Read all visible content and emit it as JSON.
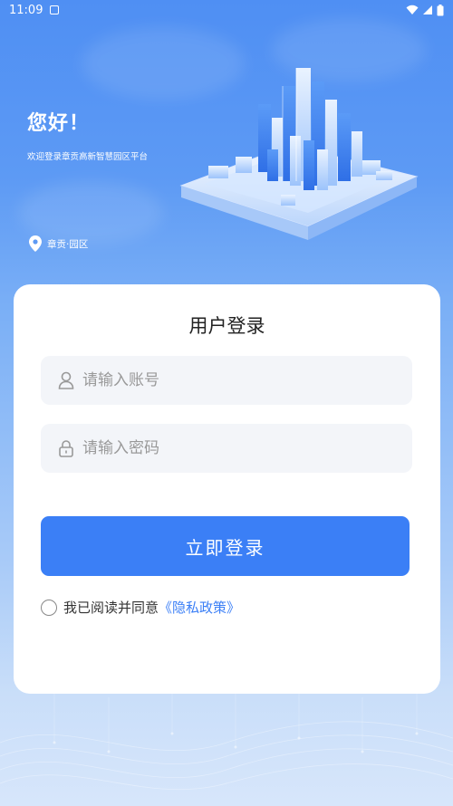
{
  "status_bar": {
    "time": "11:09"
  },
  "header": {
    "greeting": "您好！",
    "subtitle": "欢迎登录章贡高新智慧园区平台",
    "location": "章贡·园区"
  },
  "login": {
    "title": "用户登录",
    "account_placeholder": "请输入账号",
    "password_placeholder": "请输入密码",
    "submit_label": "立即登录",
    "agree_text": "我已阅读并同意",
    "policy_link": "《隐私政策》"
  },
  "colors": {
    "primary": "#3b7ff6",
    "background_top": "#4f8ff3",
    "card": "#ffffff",
    "field_bg": "#f3f5f9"
  },
  "icons": {
    "location": "map-pin-icon",
    "account": "user-icon",
    "password": "lock-icon",
    "agree": "radio-unchecked-icon"
  }
}
